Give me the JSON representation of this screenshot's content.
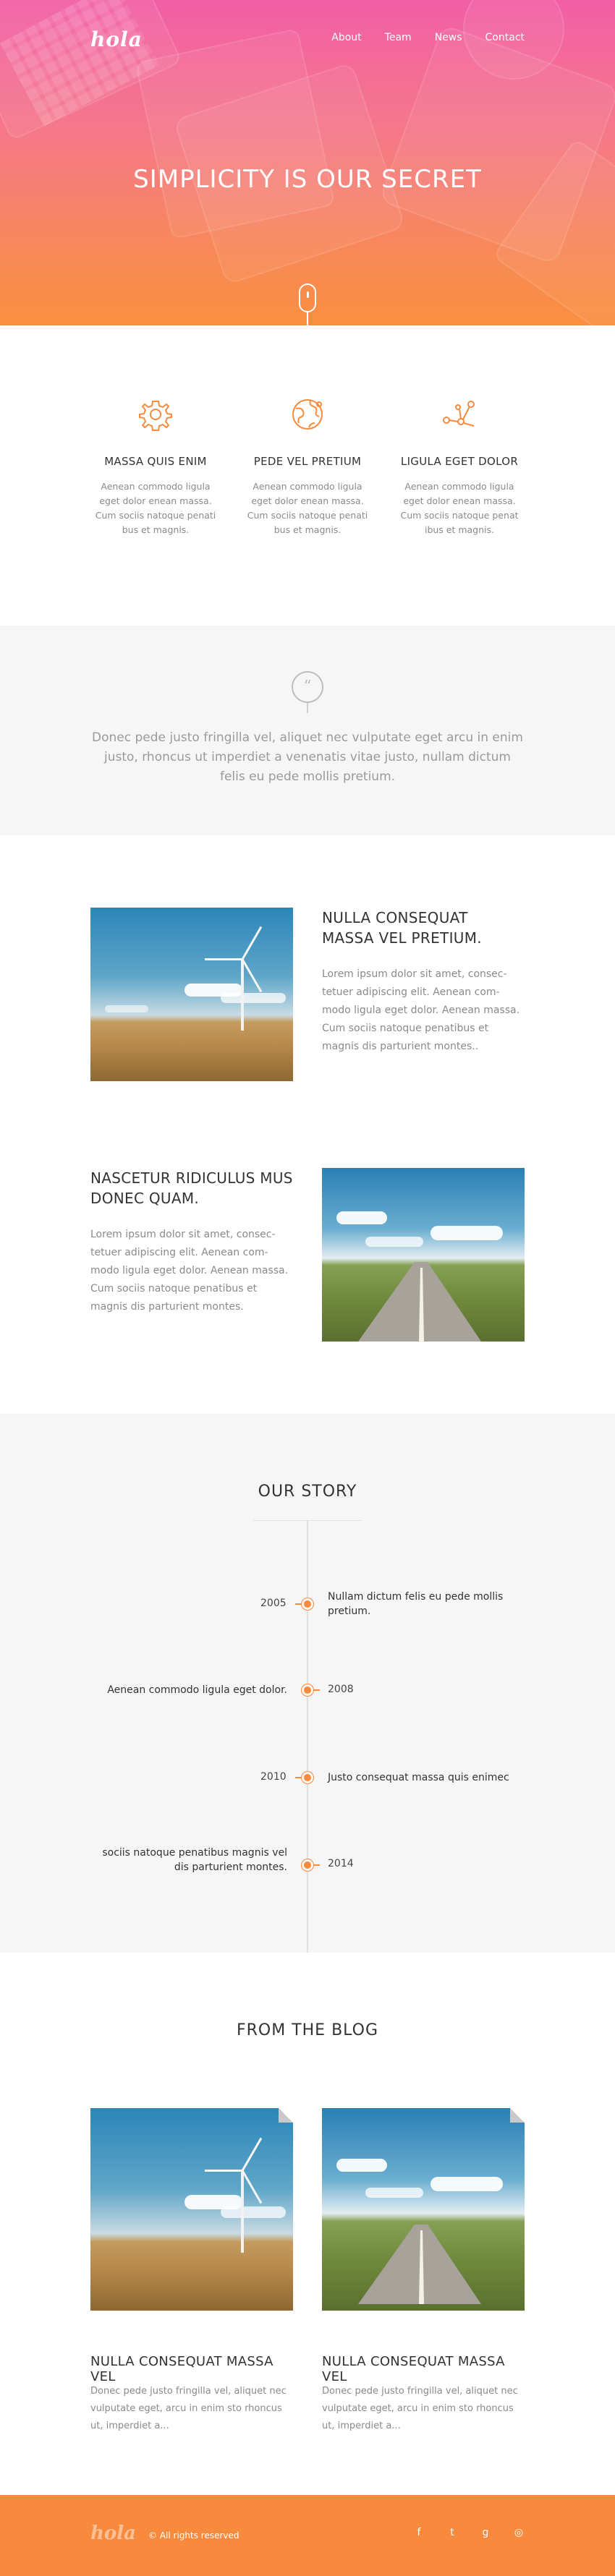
{
  "brand": {
    "logo": "hola",
    "accent": "#f88a3e",
    "hero_gradient": [
      "#f25fa6",
      "#fa8f3f"
    ]
  },
  "nav": {
    "items": [
      "About",
      "Team",
      "News",
      "Contact"
    ]
  },
  "hero": {
    "title": "SIMPLICITY IS OUR SECRET",
    "scroll_icon": "mouse-icon"
  },
  "features": [
    {
      "icon": "gear-icon",
      "title": "MASSA QUIS ENIM",
      "text": "Aenean commodo ligula eget dolor enean massa. Cum sociis natoque penati bus et magnis."
    },
    {
      "icon": "globe-icon",
      "title": "PEDE VEL PRETIUM",
      "text": "Aenean commodo ligula eget dolor enean massa. Cum sociis natoque penati bus et magnis."
    },
    {
      "icon": "nodes-icon",
      "title": "LIGULA EGET DOLOR",
      "text": "Aenean commodo ligula eget dolor enean massa. Cum sociis natoque penat ibus et magnis."
    }
  ],
  "quote": {
    "icon": "quote-icon",
    "text": "Donec pede justo fringilla vel, aliquet nec vulputate eget arcu in enim justo, rhoncus ut imperdiet a venenatis vitae justo, nullam dictum felis eu pede mollis pretium."
  },
  "articles": [
    {
      "title": "NULLA CONSEQUAT MASSA VEL PRETIUM.",
      "text": "Lorem ipsum dolor sit amet, consec-tetuer adipiscing elit. Aenean com-modo ligula eget dolor. Aenean massa. Cum sociis natoque penatibus et magnis dis parturient montes.."
    },
    {
      "title": "NASCETUR RIDICULUS MUS DONEC QUAM.",
      "text": "Lorem ipsum dolor sit amet, consec-tetuer adipiscing elit. Aenean com-modo ligula eget dolor. Aenean massa. Cum sociis natoque penatibus et magnis dis parturient montes."
    }
  ],
  "story": {
    "title": "OUR STORY",
    "events": [
      {
        "year": "2005",
        "text": "Nullam dictum felis eu pede mollis pretium."
      },
      {
        "year": "2008",
        "text": "Aenean commodo ligula eget dolor."
      },
      {
        "year": "2010",
        "text": "Justo consequat massa quis enimec"
      },
      {
        "year": "2014",
        "text": "sociis natoque penatibus magnis vel dis  parturient montes."
      }
    ]
  },
  "blog": {
    "title": "FROM THE BLOG",
    "posts": [
      {
        "title": "NULLA CONSEQUAT MASSA VEL",
        "text": "Donec pede justo  fringilla vel, aliquet nec vulputate eget, arcu in enim sto rhoncus ut, imperdiet a..."
      },
      {
        "title": "NULLA CONSEQUAT MASSA VEL",
        "text": "Donec pede justo  fringilla vel, aliquet nec vulputate eget, arcu in enim sto rhoncus ut, imperdiet a..."
      }
    ]
  },
  "footer": {
    "logo": "hola",
    "copyright": "© All rights reserved",
    "social": [
      {
        "icon": "facebook-icon",
        "glyph": "f"
      },
      {
        "icon": "twitter-icon",
        "glyph": "t"
      },
      {
        "icon": "google-plus-icon",
        "glyph": "g"
      },
      {
        "icon": "dribbble-icon",
        "glyph": "◎"
      }
    ]
  }
}
